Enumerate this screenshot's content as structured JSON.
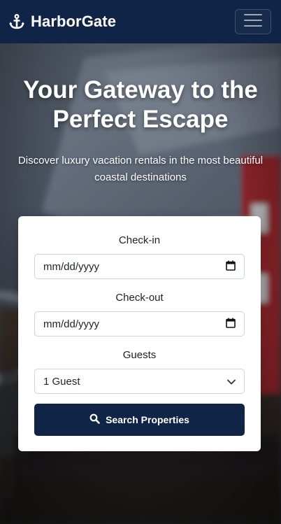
{
  "brand": {
    "name": "HarborGate",
    "icon": "anchor-icon"
  },
  "nav": {
    "toggle_icon": "hamburger-menu-icon"
  },
  "hero": {
    "title_line1": "Your Gateway to the",
    "title_line2": "Perfect Escape",
    "subtitle_line1": "Discover luxury vacation rentals in the most beautiful",
    "subtitle_line2": "coastal destinations"
  },
  "search_form": {
    "checkin_label": "Check-in",
    "checkin_value": "mm/dd/yyyy",
    "checkout_label": "Check-out",
    "checkout_value": "mm/dd/yyyy",
    "guests_label": "Guests",
    "guests_selected": "1 Guest",
    "submit_label": "Search Properties"
  },
  "colors": {
    "navy": "#0f2447",
    "white": "#ffffff"
  }
}
